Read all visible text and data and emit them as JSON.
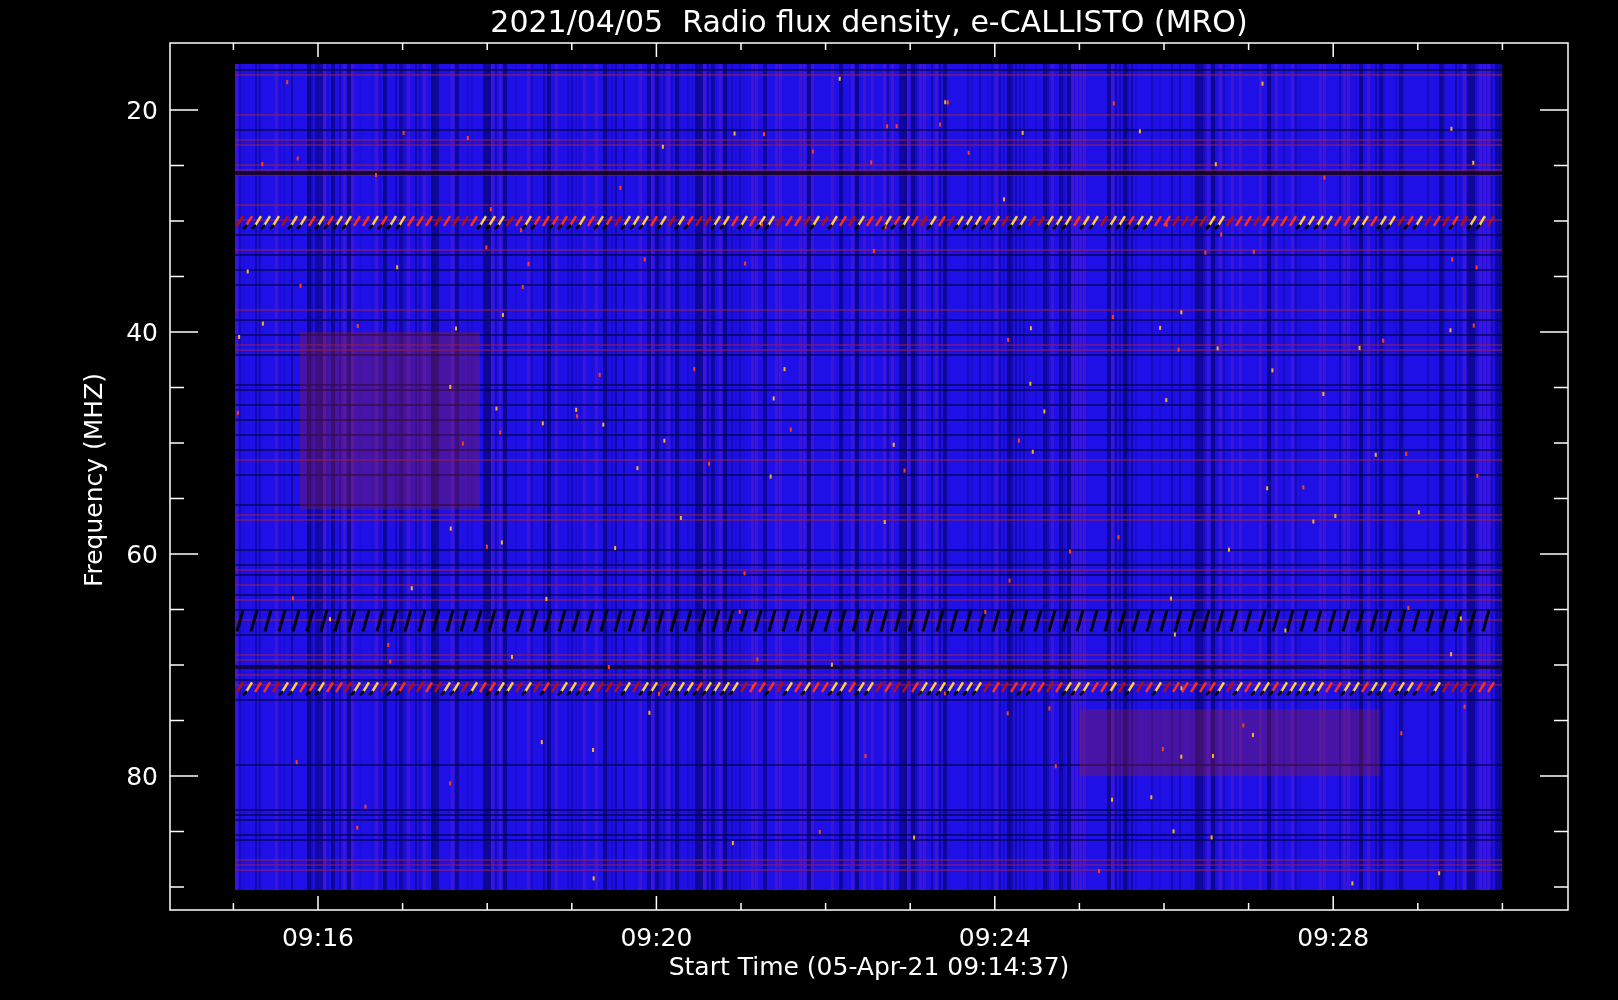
{
  "title": "2021/04/05  Radio flux density, e-CALLISTO (MRO)",
  "y_axis": {
    "label": "Frequency (MHZ)",
    "ticks": [
      "20",
      "40",
      "60",
      "80"
    ]
  },
  "x_axis": {
    "label": "Start Time (05-Apr-21 09:14:37)",
    "ticks": [
      "09:16",
      "09:20",
      "09:24",
      "09:28"
    ]
  }
}
